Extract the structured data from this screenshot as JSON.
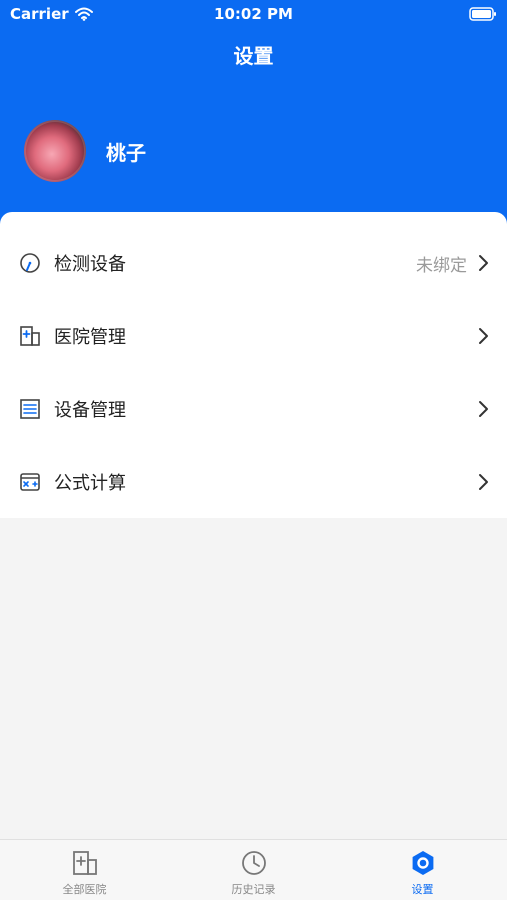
{
  "status_bar": {
    "carrier": "Carrier",
    "time": "10:02 PM"
  },
  "header": {
    "title": "设置",
    "username": "桃子",
    "background_color": "#0b6bf2"
  },
  "menu": {
    "items": [
      {
        "label": "检测设备",
        "value": "未绑定",
        "icon": "gauge-icon"
      },
      {
        "label": "医院管理",
        "value": "",
        "icon": "hospital-icon"
      },
      {
        "label": "设备管理",
        "value": "",
        "icon": "device-list-icon"
      },
      {
        "label": "公式计算",
        "value": "",
        "icon": "calculator-icon"
      }
    ]
  },
  "tabbar": {
    "tabs": [
      {
        "label": "全部医院",
        "icon": "hospital-icon",
        "active": false
      },
      {
        "label": "历史记录",
        "icon": "clock-icon",
        "active": false
      },
      {
        "label": "设置",
        "icon": "settings-icon",
        "active": true
      }
    ],
    "active_color": "#0b6bf2"
  }
}
